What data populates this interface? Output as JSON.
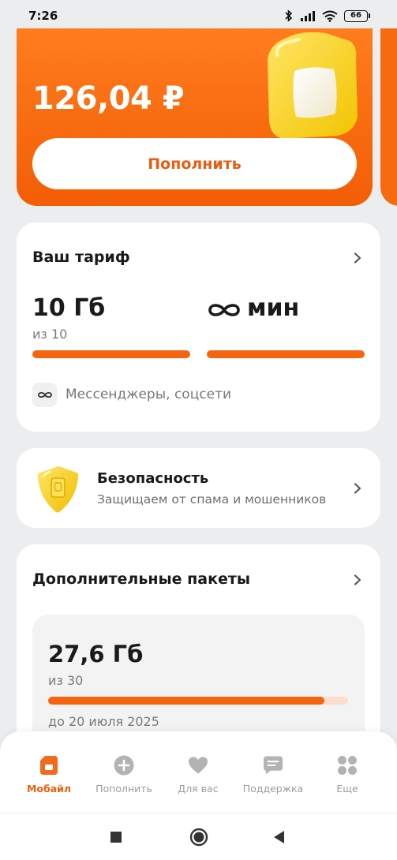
{
  "status_bar": {
    "time": "7:26",
    "battery": "66"
  },
  "balance": {
    "amount": "126,04 ₽",
    "topup_label": "Пополнить"
  },
  "tariff": {
    "title": "Ваш тариф",
    "data_amount": "10 Гб",
    "data_of": "из 10",
    "data_fill": 1.0,
    "minutes_amount": "мин",
    "minutes_fill": 1.0,
    "messengers": "Мессенджеры, соцсети"
  },
  "security": {
    "title": "Безопасность",
    "subtitle": "Защищаем от спама и мошенников"
  },
  "packs": {
    "title": "Дополнительные пакеты",
    "amount": "27,6 Гб",
    "of": "из 30",
    "fill": 0.92,
    "until": "до 20 июля 2025"
  },
  "bottom_nav": [
    {
      "label": "Мобайл",
      "icon": "sim-card-icon",
      "active": true
    },
    {
      "label": "Пополнить",
      "icon": "plus-circle-icon",
      "active": false
    },
    {
      "label": "Для вас",
      "icon": "heart-icon",
      "active": false
    },
    {
      "label": "Поддержка",
      "icon": "chat-bubble-icon",
      "active": false
    },
    {
      "label": "Еще",
      "icon": "grid-dots-icon",
      "active": false
    }
  ],
  "colors": {
    "accent": "#f56510",
    "accent_light": "#fcdccc",
    "background": "#ecedef"
  }
}
